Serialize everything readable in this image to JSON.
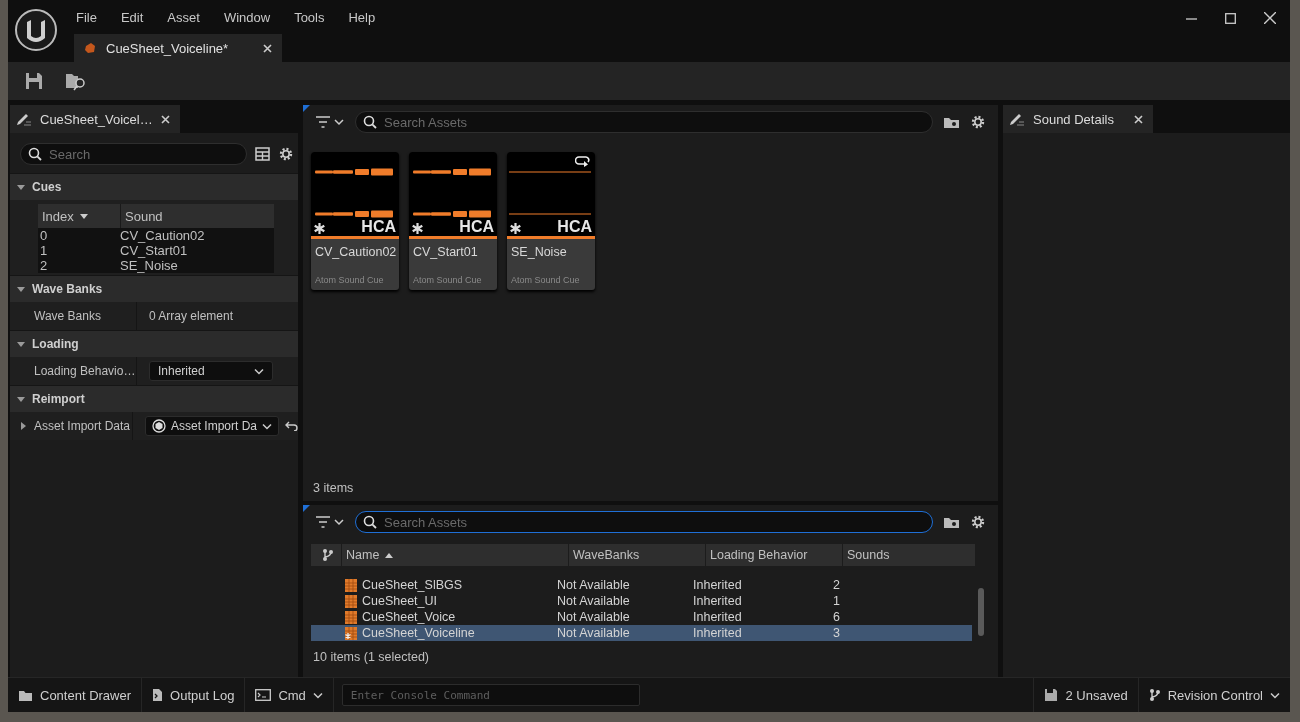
{
  "menu": [
    "File",
    "Edit",
    "Asset",
    "Window",
    "Tools",
    "Help"
  ],
  "document_tab": {
    "title": "CueSheet_Voiceline*"
  },
  "details_panel": {
    "tab": "CueSheet_Voicel…",
    "search": {
      "placeholder": "Search"
    },
    "sections": [
      {
        "title": "Cues",
        "expanded": true,
        "kind": "table",
        "columns": [
          "Index",
          "Sound"
        ],
        "rows": [
          [
            "0",
            "CV_Caution02"
          ],
          [
            "1",
            "CV_Start01"
          ],
          [
            "2",
            "SE_Noise"
          ]
        ]
      },
      {
        "title": "Wave Banks",
        "expanded": true,
        "kind": "property",
        "label": "Wave Banks",
        "value": "0 Array element"
      },
      {
        "title": "Loading",
        "expanded": true,
        "kind": "dropdown",
        "label": "Loading Behavio…",
        "value": "Inherited"
      },
      {
        "title": "Reimport",
        "expanded": true,
        "kind": "asset",
        "label": "Asset Import Data",
        "value": "Asset Import Da",
        "row_expanded": false
      }
    ]
  },
  "asset_browser": {
    "search": {
      "placeholder": "Search Assets"
    },
    "tiles": [
      {
        "kind": "speech",
        "name": "CV_Caution02",
        "type": "Atom Sound Cue",
        "badge": "HCA",
        "looping": false
      },
      {
        "kind": "speech",
        "name": "CV_Start01",
        "type": "Atom Sound Cue",
        "badge": "HCA",
        "looping": false
      },
      {
        "kind": "flat",
        "name": "SE_Noise",
        "type": "Atom Sound Cue",
        "badge": "HCA",
        "looping": true
      }
    ],
    "count": "3 items"
  },
  "asset_list": {
    "search": {
      "placeholder": "Search Assets",
      "focused": true
    },
    "columns": [
      "Name",
      "WaveBanks",
      "Loading Behavior",
      "Sounds"
    ],
    "rows": [
      {
        "name": "CueSheet_SlBGS",
        "wavebanks": "Not Available",
        "loading": "Inherited",
        "sounds": "2",
        "selected": false,
        "unsaved": false
      },
      {
        "name": "CueSheet_UI",
        "wavebanks": "Not Available",
        "loading": "Inherited",
        "sounds": "1",
        "selected": false,
        "unsaved": false
      },
      {
        "name": "CueSheet_Voice",
        "wavebanks": "Not Available",
        "loading": "Inherited",
        "sounds": "6",
        "selected": false,
        "unsaved": false
      },
      {
        "name": "CueSheet_Voiceline",
        "wavebanks": "Not Available",
        "loading": "Inherited",
        "sounds": "3",
        "selected": true,
        "unsaved": true
      }
    ],
    "count": "10 items (1 selected)"
  },
  "sound_details": {
    "tab": "Sound Details"
  },
  "status_bar": {
    "content_drawer": "Content Drawer",
    "output_log": "Output Log",
    "cmd": "Cmd",
    "console_placeholder": "Enter Console Command",
    "unsaved": "2 Unsaved",
    "revision": "Revision Control"
  }
}
